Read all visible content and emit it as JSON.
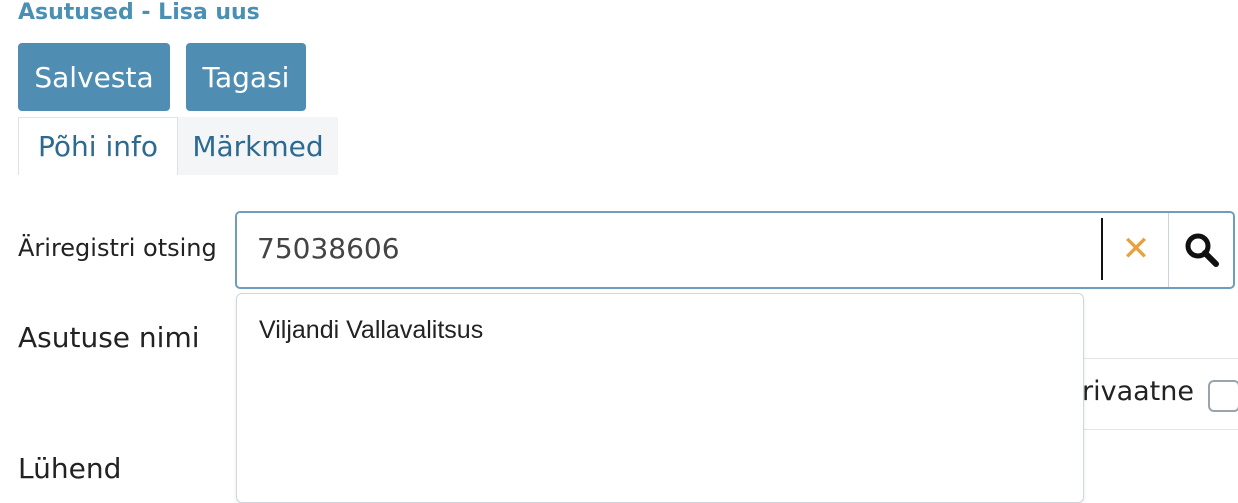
{
  "header": {
    "title": "Asutused - Lisa uus"
  },
  "toolbar": {
    "save_label": "Salvesta",
    "back_label": "Tagasi"
  },
  "tabs": [
    {
      "label": "Põhi info",
      "active": true
    },
    {
      "label": "Märkmed",
      "active": false
    }
  ],
  "form": {
    "business_registry_search": {
      "label": "Äriregistri otsing",
      "value": "75038606",
      "clear_icon": "close-icon",
      "search_icon": "search-icon"
    },
    "organization_name_label": "Asutuse nimi",
    "abbreviation_label": "Lühend",
    "private_label": "rivaatne"
  },
  "autocomplete": {
    "items": [
      "Viljandi Vallavalitsus"
    ]
  },
  "colors": {
    "primary_button": "#4f8db3",
    "title_text": "#4a8fb4",
    "clear_icon": "#e7a23f"
  }
}
